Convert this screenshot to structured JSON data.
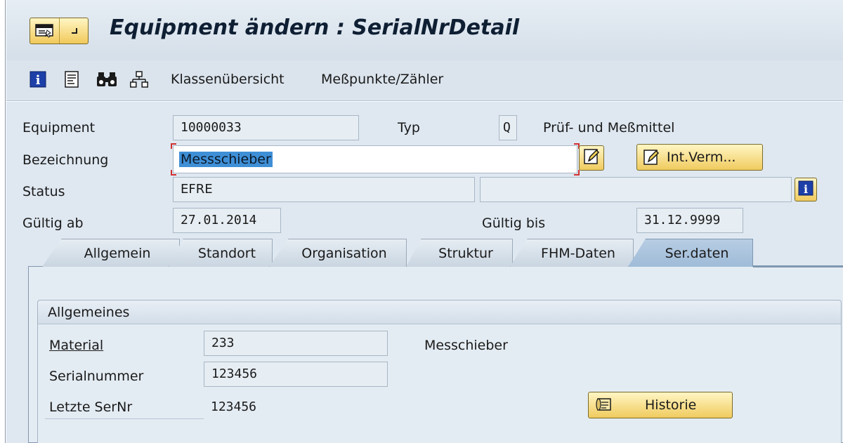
{
  "window": {
    "title": "Equipment ändern : SerialNrDetail"
  },
  "toolbar": {
    "items": [
      {
        "icon": "info-icon"
      },
      {
        "icon": "document-list-icon"
      },
      {
        "icon": "binoculars-icon"
      },
      {
        "icon": "hierarchy-icon"
      }
    ],
    "klassenuebersicht_label": "Klassenübersicht",
    "messpunkte_label": "Meßpunkte/Zähler"
  },
  "header": {
    "equipment_label": "Equipment",
    "equipment_value": "10000033",
    "typ_label": "Typ",
    "typ_value": "Q",
    "typ_text": "Prüf- und Meßmittel",
    "bezeichnung_label": "Bezeichnung",
    "bezeichnung_value": "Messschieber",
    "int_verm_label": "Int.Verm...",
    "status_label": "Status",
    "status_value": "EFRE",
    "status_value2": "",
    "gueltig_ab_label": "Gültig ab",
    "gueltig_ab_value": "27.01.2014",
    "gueltig_bis_label": "Gültig bis",
    "gueltig_bis_value": "31.12.9999"
  },
  "tabs": [
    {
      "label": "Allgemein"
    },
    {
      "label": "Standort"
    },
    {
      "label": "Organisation"
    },
    {
      "label": "Struktur"
    },
    {
      "label": "FHM-Daten"
    },
    {
      "label": "Ser.daten",
      "active": true
    }
  ],
  "group": {
    "title": "Allgemeines",
    "material_label": "Material",
    "material_value": "233",
    "material_text": "Messchieber",
    "serialnummer_label": "Serialnummer",
    "serialnummer_value": "123456",
    "letzte_sernr_label": "Letzte SerNr",
    "letzte_sernr_value": "123456",
    "historie_label": "Historie"
  },
  "colors": {
    "button_gold": "#f0cb5e",
    "panel_blue": "#dfe8f1",
    "active_tab": "#9fbbd8",
    "required_red": "#d13030",
    "selection_blue": "#3f8fd6"
  }
}
